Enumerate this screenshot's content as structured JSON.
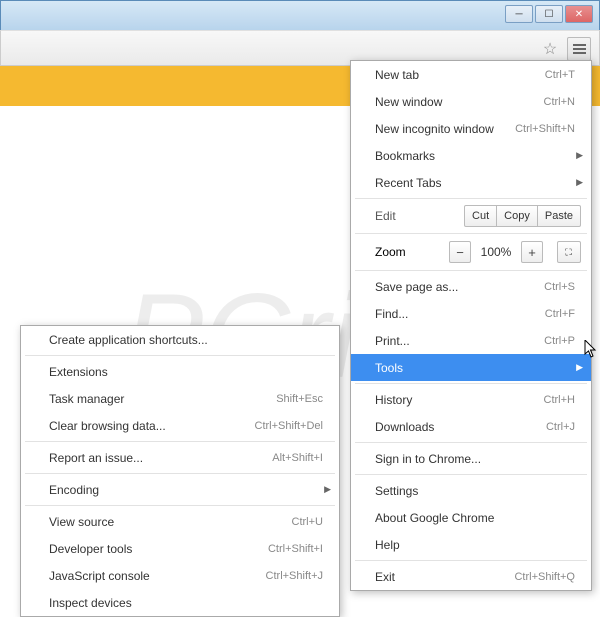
{
  "window": {
    "min": "─",
    "max": "☐",
    "close": "✕"
  },
  "main_menu": {
    "new_tab": {
      "label": "New tab",
      "sc": "Ctrl+T"
    },
    "new_window": {
      "label": "New window",
      "sc": "Ctrl+N"
    },
    "incognito": {
      "label": "New incognito window",
      "sc": "Ctrl+Shift+N"
    },
    "bookmarks": {
      "label": "Bookmarks"
    },
    "recent_tabs": {
      "label": "Recent Tabs"
    },
    "edit": {
      "label": "Edit",
      "cut": "Cut",
      "copy": "Copy",
      "paste": "Paste"
    },
    "zoom": {
      "label": "Zoom",
      "minus": "−",
      "value": "100%",
      "plus": "+"
    },
    "save_page": {
      "label": "Save page as...",
      "sc": "Ctrl+S"
    },
    "find": {
      "label": "Find...",
      "sc": "Ctrl+F"
    },
    "print": {
      "label": "Print...",
      "sc": "Ctrl+P"
    },
    "tools": {
      "label": "Tools"
    },
    "history": {
      "label": "History",
      "sc": "Ctrl+H"
    },
    "downloads": {
      "label": "Downloads",
      "sc": "Ctrl+J"
    },
    "signin": {
      "label": "Sign in to Chrome..."
    },
    "settings": {
      "label": "Settings"
    },
    "about": {
      "label": "About Google Chrome"
    },
    "help": {
      "label": "Help"
    },
    "exit": {
      "label": "Exit",
      "sc": "Ctrl+Shift+Q"
    }
  },
  "tools_menu": {
    "create_shortcuts": {
      "label": "Create application shortcuts..."
    },
    "extensions": {
      "label": "Extensions"
    },
    "task_manager": {
      "label": "Task manager",
      "sc": "Shift+Esc"
    },
    "clear_data": {
      "label": "Clear browsing data...",
      "sc": "Ctrl+Shift+Del"
    },
    "report_issue": {
      "label": "Report an issue...",
      "sc": "Alt+Shift+I"
    },
    "encoding": {
      "label": "Encoding"
    },
    "view_source": {
      "label": "View source",
      "sc": "Ctrl+U"
    },
    "dev_tools": {
      "label": "Developer tools",
      "sc": "Ctrl+Shift+I"
    },
    "js_console": {
      "label": "JavaScript console",
      "sc": "Ctrl+Shift+J"
    },
    "inspect_devices": {
      "label": "Inspect devices"
    }
  }
}
